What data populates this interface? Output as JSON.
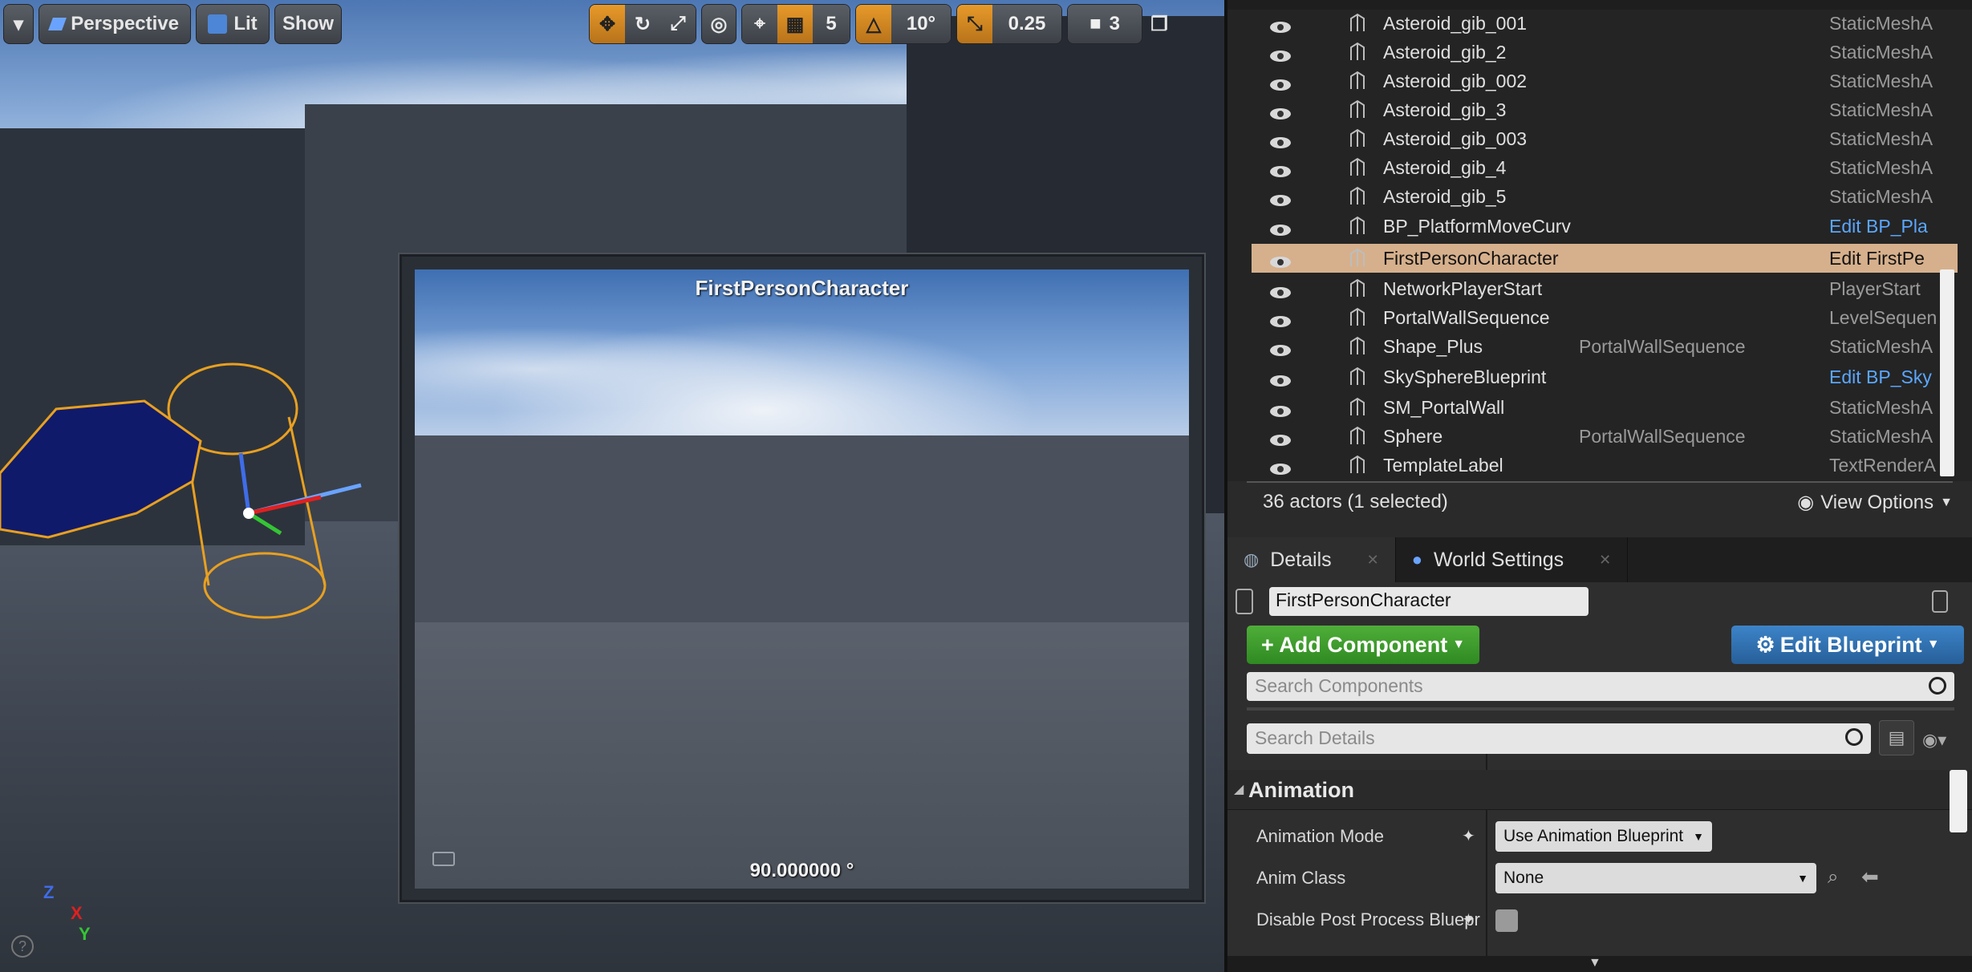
{
  "viewport": {
    "toolbar": {
      "perspective_label": "Perspective",
      "lit_label": "Lit",
      "show_label": "Show",
      "grid_snap_value": "5",
      "rotation_snap_value": "10°",
      "scale_snap_value": "0.25",
      "camera_speed_value": "3"
    },
    "preview": {
      "title": "FirstPersonCharacter",
      "angle": "90.000000 °"
    },
    "axes": {
      "x": "X",
      "y": "Y",
      "z": "Z"
    }
  },
  "outliner": {
    "rows": [
      {
        "name": "Asteroid_gib_001",
        "folder": "",
        "type": "StaticMeshA",
        "link": false,
        "selected": false,
        "icon": "static-mesh-icon"
      },
      {
        "name": "Asteroid_gib_2",
        "folder": "",
        "type": "StaticMeshA",
        "link": false,
        "selected": false,
        "icon": "static-mesh-icon"
      },
      {
        "name": "Asteroid_gib_002",
        "folder": "",
        "type": "StaticMeshA",
        "link": false,
        "selected": false,
        "icon": "static-mesh-icon"
      },
      {
        "name": "Asteroid_gib_3",
        "folder": "",
        "type": "StaticMeshA",
        "link": false,
        "selected": false,
        "icon": "static-mesh-icon"
      },
      {
        "name": "Asteroid_gib_003",
        "folder": "",
        "type": "StaticMeshA",
        "link": false,
        "selected": false,
        "icon": "static-mesh-icon"
      },
      {
        "name": "Asteroid_gib_4",
        "folder": "",
        "type": "StaticMeshA",
        "link": false,
        "selected": false,
        "icon": "static-mesh-icon"
      },
      {
        "name": "Asteroid_gib_5",
        "folder": "",
        "type": "StaticMeshA",
        "link": false,
        "selected": false,
        "icon": "static-mesh-icon"
      },
      {
        "name": "BP_PlatformMoveCurv",
        "folder": "",
        "type": "Edit BP_Pla",
        "link": true,
        "selected": false,
        "icon": "blueprint-sphere-icon"
      },
      {
        "name": "FirstPersonCharacter",
        "folder": "",
        "type": "Edit FirstPe",
        "link": true,
        "selected": true,
        "icon": "character-icon"
      },
      {
        "name": "NetworkPlayerStart",
        "folder": "",
        "type": "PlayerStart",
        "link": false,
        "selected": false,
        "icon": "player-start-icon"
      },
      {
        "name": "PortalWallSequence",
        "folder": "",
        "type": "LevelSequen",
        "link": false,
        "selected": false,
        "icon": "sequence-icon"
      },
      {
        "name": "Shape_Plus",
        "folder": "PortalWallSequence",
        "type": "StaticMeshA",
        "link": false,
        "selected": false,
        "icon": "static-mesh-icon"
      },
      {
        "name": "SkySphereBlueprint",
        "folder": "",
        "type": "Edit BP_Sky",
        "link": true,
        "selected": false,
        "icon": "sphere-icon"
      },
      {
        "name": "SM_PortalWall",
        "folder": "",
        "type": "StaticMeshA",
        "link": false,
        "selected": false,
        "icon": "static-mesh-icon"
      },
      {
        "name": "Sphere",
        "folder": "PortalWallSequence",
        "type": "StaticMeshA",
        "link": false,
        "selected": false,
        "icon": "static-mesh-icon"
      },
      {
        "name": "TemplateLabel",
        "folder": "",
        "type": "TextRenderA",
        "link": false,
        "selected": false,
        "icon": "text-render-icon"
      }
    ],
    "status": "36 actors (1 selected)",
    "view_options_label": "View Options"
  },
  "details": {
    "tabs": [
      {
        "label": "Details"
      },
      {
        "label": "World Settings"
      }
    ],
    "actor_name": "FirstPersonCharacter",
    "add_component_label": "+ Add Component",
    "edit_blueprint_label": "Edit Blueprint",
    "search_components_placeholder": "Search Components",
    "search_details_placeholder": "Search Details",
    "section_label": "Animation",
    "properties": [
      {
        "label": "Animation Mode",
        "value": "Use Animation Blueprint"
      },
      {
        "label": "Anim Class",
        "value": "None"
      },
      {
        "label": "Disable Post Process Bluepri",
        "value": ""
      }
    ]
  },
  "colors": {
    "accent_orange": "#e79a2a",
    "selection": "#d6b08c",
    "link_blue": "#5aa7ff",
    "add_green": "#4fae39",
    "blueprint_blue": "#3c84c8"
  }
}
